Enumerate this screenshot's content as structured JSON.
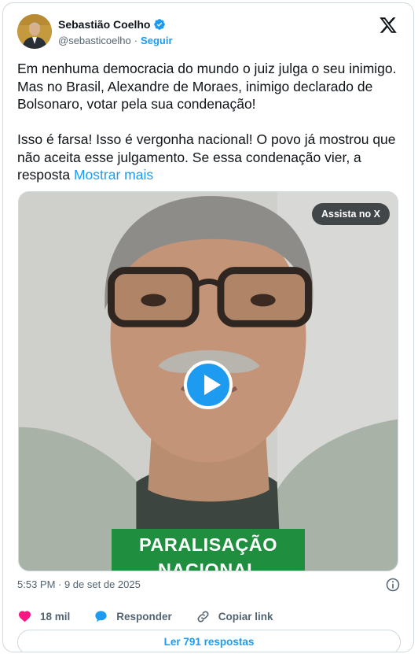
{
  "author": {
    "name": "Sebastião Coelho",
    "handle": "@sebasticoelho",
    "separator": "·",
    "follow_label": "Seguir"
  },
  "tweet": {
    "text": "Em nenhuma democracia do mundo o juiz julga o seu inimigo. Mas no Brasil, Alexandre de Moraes, inimigo declarado de Bolsonaro, votar pela sua condenação!\n\nIsso é farsa! Isso é vergonha nacional! O povo já mostrou que não aceita esse julgamento. Se essa condenação vier, a resposta ",
    "show_more_label": "Mostrar mais"
  },
  "media": {
    "watch_on_x_label": "Assista no X",
    "banner_line1": "PARALISAÇÃO",
    "banner_line2": "NACIONAL"
  },
  "meta": {
    "timestamp": "5:53 PM · 9 de set de 2025"
  },
  "actions": {
    "likes_count": "18 mil",
    "reply_label": "Responder",
    "copy_link_label": "Copiar link"
  },
  "replies_button_label": "Ler 791 respostas",
  "colors": {
    "accent": "#1d9bf0",
    "like": "#f91880",
    "banner": "#1f8e3e",
    "muted": "#536471"
  },
  "icons": [
    "verified-badge-icon",
    "x-logo-icon",
    "play-icon",
    "info-icon",
    "heart-icon",
    "reply-bubble-icon",
    "link-icon"
  ]
}
